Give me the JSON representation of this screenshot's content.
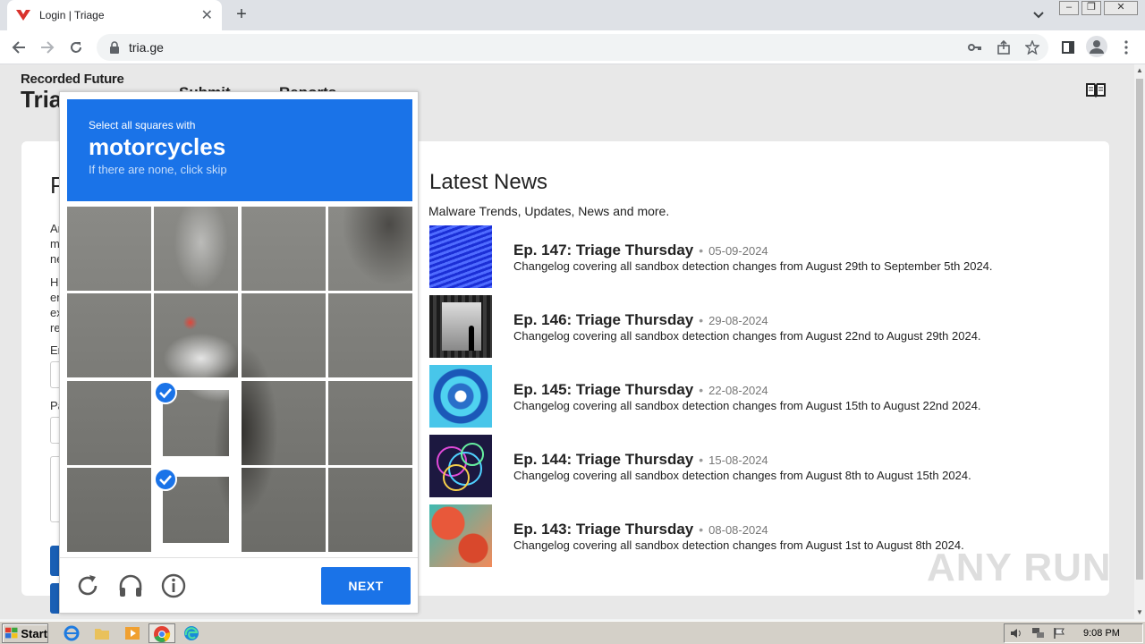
{
  "browser": {
    "tab_title": "Login | Triage",
    "tab_close": "✕",
    "new_tab": "+",
    "url": "tria.ge"
  },
  "site": {
    "brand_top": "Recorded Future",
    "brand_bottom": "Tria",
    "nav": [
      "Submit",
      "Reports"
    ]
  },
  "login": {
    "heading_fragment": "P",
    "text_lines": [
      "Ar",
      "m",
      "ne",
      "Hi",
      "en",
      "ex",
      "re",
      "Er",
      "Pa"
    ]
  },
  "news": {
    "title": "Latest News",
    "subtitle": "Malware Trends, Updates, News and more.",
    "items": [
      {
        "headline": "Ep. 147: Triage Thursday",
        "date": "05-09-2024",
        "desc": "Changelog covering all sandbox detection changes from August 29th to September 5th 2024.",
        "thumb": "blue-wave"
      },
      {
        "headline": "Ep. 146: Triage Thursday",
        "date": "29-08-2024",
        "desc": "Changelog covering all sandbox detection changes from August 22nd to August 29th 2024.",
        "thumb": "dark-silhouette"
      },
      {
        "headline": "Ep. 145: Triage Thursday",
        "date": "22-08-2024",
        "desc": "Changelog covering all sandbox detection changes from August 15th to August 22nd 2024.",
        "thumb": "cyan-tunnel"
      },
      {
        "headline": "Ep. 144: Triage Thursday",
        "date": "15-08-2024",
        "desc": "Changelog covering all sandbox detection changes from August 8th to August 15th 2024.",
        "thumb": "neon-rings"
      },
      {
        "headline": "Ep. 143: Triage Thursday",
        "date": "08-08-2024",
        "desc": "Changelog covering all sandbox detection changes from August 1st to August 8th 2024.",
        "thumb": "coral-reef"
      }
    ]
  },
  "captcha": {
    "instruction": "Select all squares with",
    "target": "motorcycles",
    "hint": "If there are none, click skip",
    "next_label": "NEXT",
    "selected_cells": [
      9,
      13
    ],
    "accent": "#1a73e8"
  },
  "taskbar": {
    "start_label": "Start",
    "clock": "9:08 PM"
  },
  "watermark": "ANY RUN"
}
